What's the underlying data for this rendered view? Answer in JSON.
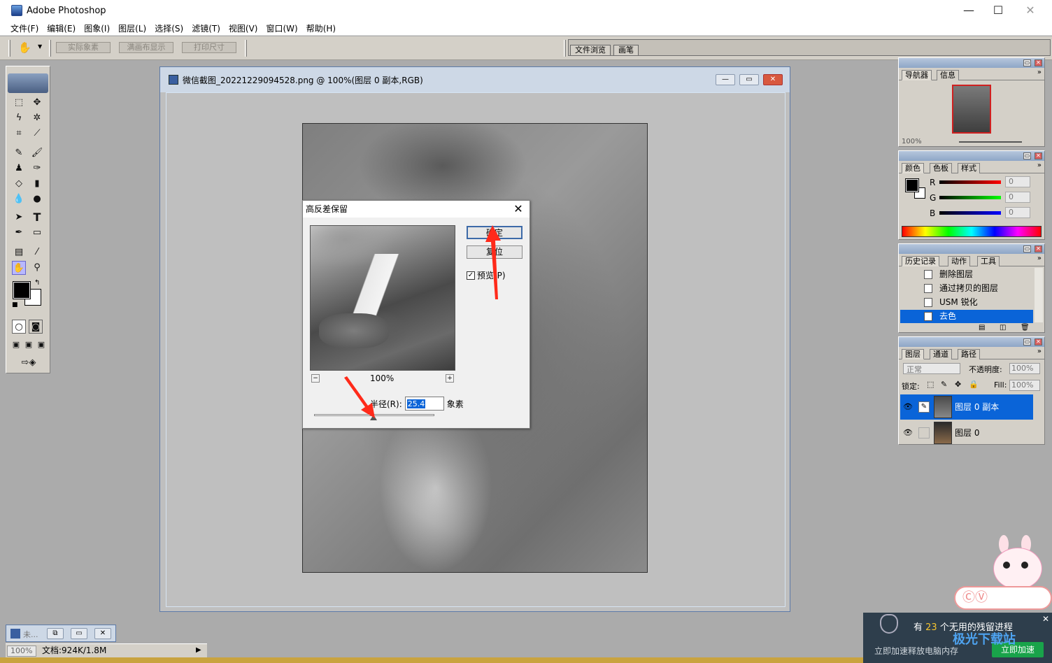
{
  "app": {
    "title": "Adobe Photoshop"
  },
  "window_controls": {
    "minimize": "—",
    "maximize": "☐",
    "close": "✕"
  },
  "menu": [
    "文件(F)",
    "编辑(E)",
    "图象(I)",
    "图层(L)",
    "选择(S)",
    "滤镜(T)",
    "视图(V)",
    "窗口(W)",
    "帮助(H)"
  ],
  "options": {
    "buttons": [
      "实际象素",
      "满画布显示",
      "打印尺寸"
    ]
  },
  "well": {
    "tabs": [
      "文件浏览",
      "画笔"
    ]
  },
  "document": {
    "title": "微信截图_20221229094528.png @ 100%(图层 0 副本,RGB)"
  },
  "dialog": {
    "title": "高反差保留",
    "zoom": "100%",
    "ok": "确定",
    "reset": "复位",
    "preview_label": "预览(P)",
    "radius_label": "半径(R):",
    "radius_value": "25.4",
    "unit": "象素",
    "slider_position": 0.5
  },
  "navigator": {
    "tabs": [
      "导航器",
      "信息"
    ],
    "zoom": "100%"
  },
  "color": {
    "tabs": [
      "颜色",
      "色板",
      "样式"
    ],
    "channels": [
      {
        "name": "R",
        "value": "0",
        "color": "#d00000"
      },
      {
        "name": "G",
        "value": "0",
        "color": "#00a000"
      },
      {
        "name": "B",
        "value": "0",
        "color": "#0000c8"
      }
    ]
  },
  "history": {
    "tabs": [
      "历史记录",
      "动作",
      "工具"
    ],
    "items": [
      "删除图层",
      "通过拷贝的图层",
      "USM 锐化",
      "去色"
    ],
    "selected_index": 3
  },
  "layers": {
    "tabs": [
      "图层",
      "通道",
      "路径"
    ],
    "blend_mode": "正常",
    "opacity_label": "不透明度:",
    "opacity_value": "100%",
    "lock_label": "锁定:",
    "fill_label": "Fill:",
    "fill_value": "100%",
    "items": [
      {
        "name": "图层 0 副本",
        "selected": true
      },
      {
        "name": "图层 0",
        "selected": false
      }
    ]
  },
  "mini_doc": {
    "title": "未..."
  },
  "status": {
    "zoom": "100%",
    "doc_info": "文档:924K/1.8M"
  },
  "notification": {
    "line1_prefix": "有",
    "count": "23",
    "line1_suffix": "个无用的残留进程",
    "line2": "立即加速释放电脑内存",
    "button": "立即加速",
    "watermark": "极光下载站"
  },
  "colors": {
    "accent": "#0a64d8",
    "arrow": "#ff2a1a"
  }
}
